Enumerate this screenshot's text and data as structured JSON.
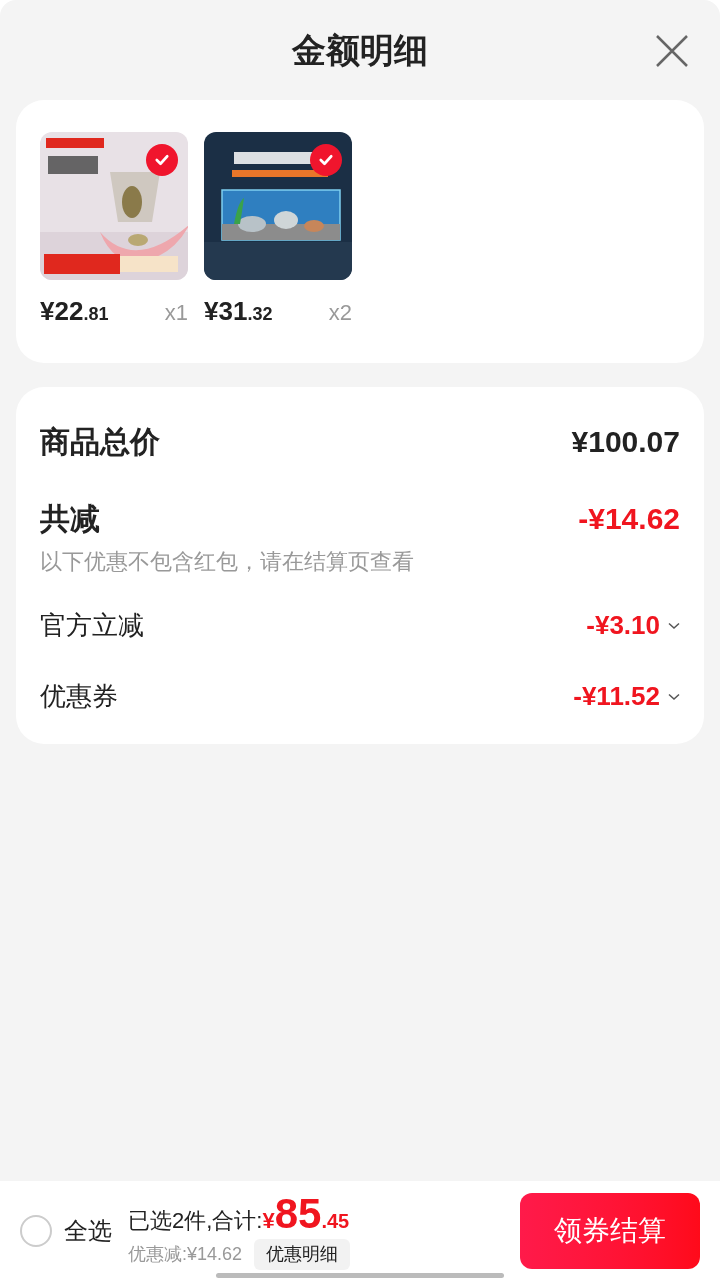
{
  "header": {
    "title": "金额明细"
  },
  "products": [
    {
      "kind": "hammock",
      "checked": true,
      "price_main": "¥22",
      "price_decimal": ".81",
      "quantity": "x1"
    },
    {
      "kind": "aquarium",
      "checked": true,
      "price_main": "¥31",
      "price_decimal": ".32",
      "quantity": "x2"
    }
  ],
  "summary": {
    "total_label": "商品总价",
    "total_value": "¥100.07",
    "discount_label": "共减",
    "discount_value": "-¥14.62",
    "note": "以下优惠不包含红包，请在结算页查看",
    "items": [
      {
        "label": "官方立减",
        "value": "-¥3.10",
        "expanded": false
      },
      {
        "label": "优惠券",
        "value": "-¥11.52",
        "expanded": false
      }
    ]
  },
  "footer": {
    "select_all": {
      "label": "全选",
      "checked": false
    },
    "selected_text": "已选2件,合计:",
    "currency": "¥",
    "total_integer": "85",
    "total_decimal": ".45",
    "saved_text": "优惠减:¥14.62",
    "detail_button": "优惠明细",
    "checkout_button": "领券结算"
  }
}
